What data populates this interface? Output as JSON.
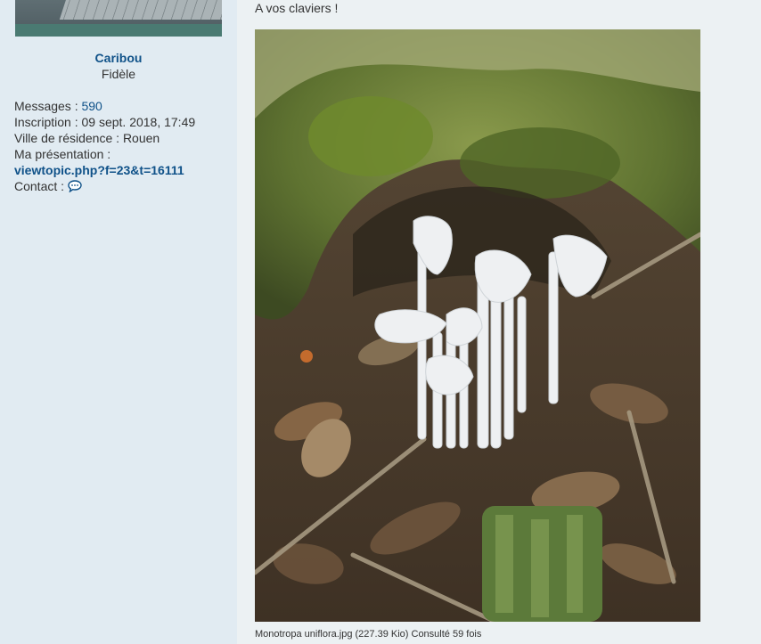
{
  "profile": {
    "username": "Caribou",
    "rank": "Fidèle",
    "messages_label": "Messages : ",
    "messages_count": "590",
    "joined_label": "Inscription : ",
    "joined_value": "09 sept. 2018, 17:49",
    "city_label": "Ville de résidence : ",
    "city_value": "Rouen",
    "presentation_label": "Ma présentation :",
    "presentation_link": "viewtopic.php?f=23&t=16111",
    "contact_label": "Contact : ",
    "contact_icon": "speech-bubble-icon"
  },
  "post": {
    "text": "A vos claviers !",
    "attachment_caption": "Monotropa uniflora.jpg (227.39 Kio) Consulté 59 fois"
  },
  "colors": {
    "sidebar_bg": "#e1ebf2",
    "content_bg": "#ecf1f3",
    "link": "#105289"
  }
}
